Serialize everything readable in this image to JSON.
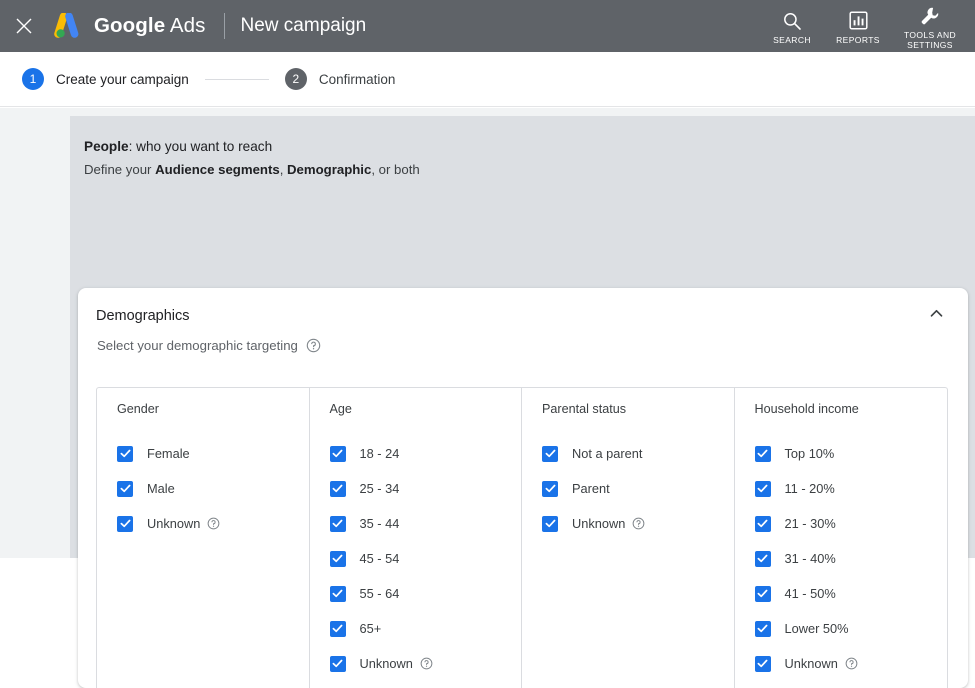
{
  "appbar": {
    "close_icon": "close-icon",
    "brand_bold": "Google",
    "brand_thin": "Ads",
    "page_title": "New campaign",
    "actions": [
      {
        "icon": "search-icon",
        "label": "SEARCH"
      },
      {
        "icon": "reports-icon",
        "label": "REPORTS"
      },
      {
        "icon": "tools-icon",
        "label": "TOOLS AND\nSETTINGS"
      }
    ]
  },
  "stepper": {
    "steps": [
      {
        "num": "1",
        "label": "Create your campaign",
        "state": "active"
      },
      {
        "num": "2",
        "label": "Confirmation",
        "state": "inactive"
      }
    ]
  },
  "people": {
    "heading_bold": "People",
    "heading_rest": ": who you want to reach",
    "sub_pre": "Define your ",
    "sub_b1": "Audience segments",
    "sub_mid": ", ",
    "sub_b2": "Demographic",
    "sub_post": ", or both"
  },
  "card": {
    "title": "Demographics",
    "collapse_icon": "chevron-up-icon",
    "subtitle": "Select your demographic targeting",
    "subtitle_help_icon": "help-circle-icon"
  },
  "colors": {
    "accent": "#1a73e8",
    "appbar": "#5f6368",
    "panel": "#dcdfe3",
    "page_bg": "#f1f3f4",
    "border": "#dadce0",
    "text_primary": "#202124",
    "text_secondary": "#5f6368"
  },
  "demographics": {
    "columns": [
      {
        "title": "Gender",
        "options": [
          {
            "label": "Female",
            "checked": true,
            "help": false
          },
          {
            "label": "Male",
            "checked": true,
            "help": false
          },
          {
            "label": "Unknown",
            "checked": true,
            "help": true
          }
        ]
      },
      {
        "title": "Age",
        "options": [
          {
            "label": "18 - 24",
            "checked": true,
            "help": false
          },
          {
            "label": "25 - 34",
            "checked": true,
            "help": false
          },
          {
            "label": "35 - 44",
            "checked": true,
            "help": false
          },
          {
            "label": "45 - 54",
            "checked": true,
            "help": false
          },
          {
            "label": "55 - 64",
            "checked": true,
            "help": false
          },
          {
            "label": "65+",
            "checked": true,
            "help": false
          },
          {
            "label": "Unknown",
            "checked": true,
            "help": true
          }
        ]
      },
      {
        "title": "Parental status",
        "options": [
          {
            "label": "Not a parent",
            "checked": true,
            "help": false
          },
          {
            "label": "Parent",
            "checked": true,
            "help": false
          },
          {
            "label": "Unknown",
            "checked": true,
            "help": true
          }
        ]
      },
      {
        "title": "Household income",
        "options": [
          {
            "label": "Top 10%",
            "checked": true,
            "help": false
          },
          {
            "label": "11 - 20%",
            "checked": true,
            "help": false
          },
          {
            "label": "21 - 30%",
            "checked": true,
            "help": false
          },
          {
            "label": "31 - 40%",
            "checked": true,
            "help": false
          },
          {
            "label": "41 - 50%",
            "checked": true,
            "help": false
          },
          {
            "label": "Lower 50%",
            "checked": true,
            "help": false
          },
          {
            "label": "Unknown",
            "checked": true,
            "help": true
          }
        ]
      }
    ]
  }
}
